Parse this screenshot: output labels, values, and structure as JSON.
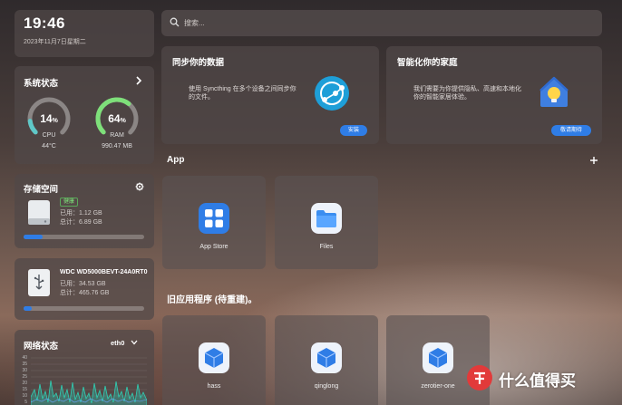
{
  "clock": {
    "time": "19:46",
    "date": "2023年11月7日星期二"
  },
  "system": {
    "title": "系统状态",
    "cpu": {
      "percent": 14,
      "value": "14",
      "unit": "%",
      "label": "CPU",
      "sub": "44°C"
    },
    "ram": {
      "percent": 64,
      "value": "64",
      "unit": "%",
      "label": "RAM",
      "sub": "990.47 MB"
    },
    "colors": {
      "cpu": "#5fc8c8",
      "ram": "#7ee07a",
      "track": "#8b8685"
    }
  },
  "storage": {
    "title": "存储空间",
    "badge": "健康",
    "used": "已用：1.12 GB",
    "total": "总计：6.89 GB",
    "fill": 0.16
  },
  "disk2": {
    "name": "WDC WD5000BEVT-24A0RT0",
    "used": "已用：34.53 GB",
    "total": "总计：465.76 GB",
    "fill": 0.07
  },
  "network": {
    "title": "网络状态",
    "iface": "eth0",
    "yticks": [
      "40",
      "35",
      "30",
      "25",
      "20",
      "15",
      "10",
      "5"
    ]
  },
  "search": {
    "placeholder": "搜索..."
  },
  "promo_sync": {
    "title": "同步你的数据",
    "desc": "使用 Syncthing 在多个设备之间同步你的文件。",
    "button": "安装"
  },
  "promo_home": {
    "title": "智能化你的家庭",
    "desc": "我们需要为你提供隐私、高速和本地化你的智能家居体验。",
    "button": "敬请期待"
  },
  "apps": {
    "title": "App",
    "add_icon": "plus-icon",
    "items": [
      {
        "label": "App Store",
        "icon": "app-store-icon"
      },
      {
        "label": "Files",
        "icon": "folder-icon"
      }
    ]
  },
  "legacy": {
    "title": "旧应用程序 (待重建)。",
    "items": [
      {
        "label": "hass"
      },
      {
        "label": "qinglong"
      },
      {
        "label": "zerotier-one"
      }
    ]
  },
  "watermark": {
    "text": "什么值得买"
  }
}
